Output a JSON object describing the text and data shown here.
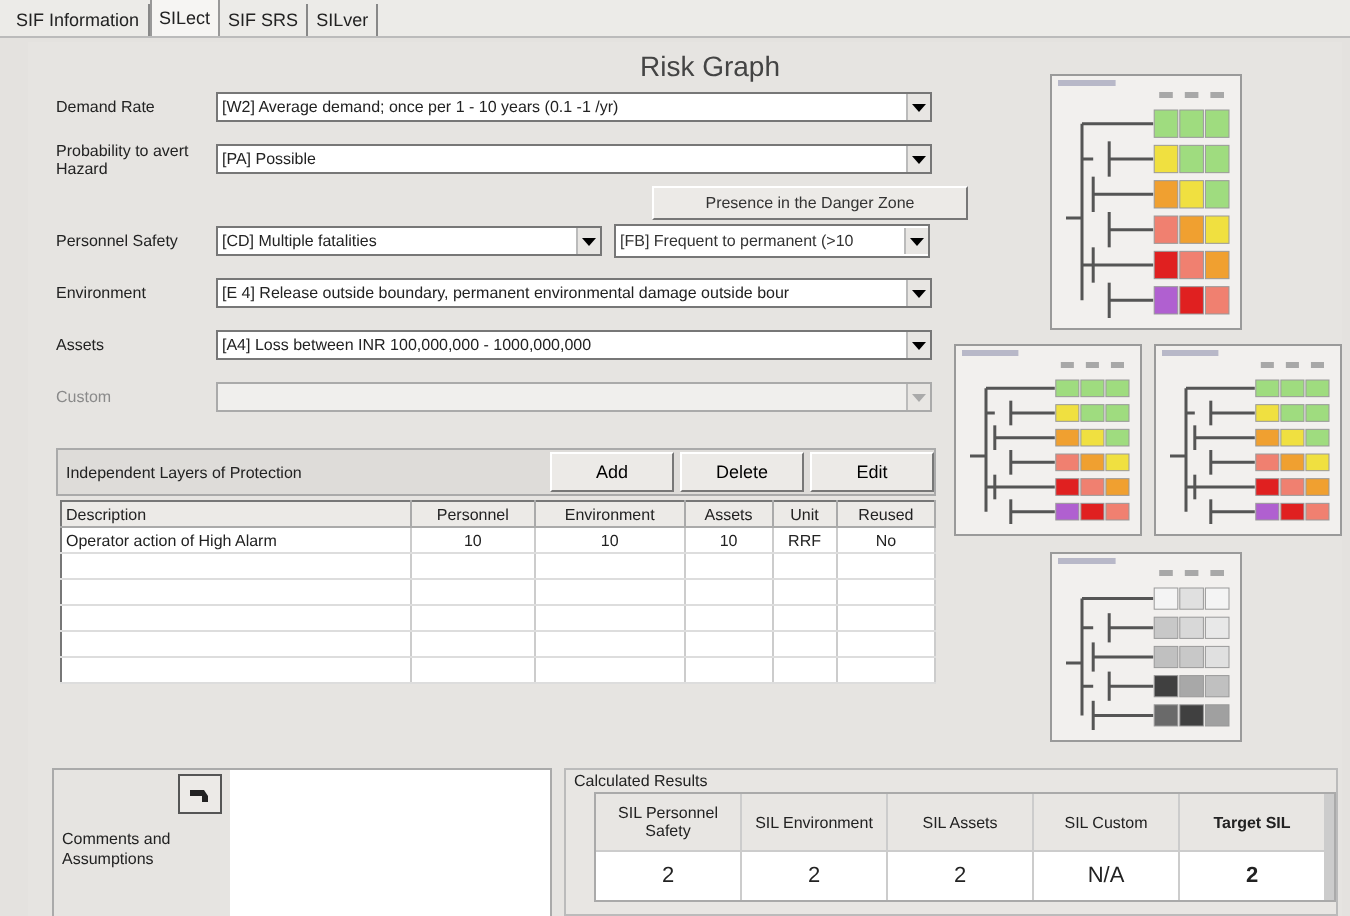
{
  "tabs": [
    {
      "label": "SIF Information",
      "selected": false
    },
    {
      "label": "SILect",
      "selected": true
    },
    {
      "label": "SIF SRS",
      "selected": false
    },
    {
      "label": "SILver",
      "selected": false
    }
  ],
  "title": "Risk Graph",
  "parameters": [
    {
      "kind": "select",
      "label": "Demand Rate",
      "value": "[W2] Average demand; once per 1 - 10 years (0.1 -1 /yr)",
      "disabled": false
    },
    {
      "kind": "select",
      "label": "Probability to avert Hazard",
      "value": "[PA] Possible",
      "disabled": false
    },
    {
      "kind": "split",
      "label": "Personnel Safety",
      "value": "[CD] Multiple fatalities",
      "zone_button": "Presence in the Danger Zone",
      "zone_value": "[FB] Frequent to permanent (>10",
      "disabled": false
    },
    {
      "kind": "select",
      "label": "Environment",
      "value": "[E 4] Release outside boundary, permanent environmental damage outside bour",
      "disabled": false
    },
    {
      "kind": "select",
      "label": "Assets",
      "value": "[A4] Loss between INR 100,000,000 - 1000,000,000",
      "disabled": false
    },
    {
      "kind": "select",
      "label": "Custom",
      "disabled": true
    }
  ],
  "ilp": {
    "title": "Independent Layers of Protection",
    "buttons": [
      "Add",
      "Delete",
      "Edit"
    ],
    "columns": [
      "Description",
      "Personnel",
      "Environment",
      "Assets",
      "Unit",
      "Reused"
    ],
    "rows": [
      [
        "Operator action of High Alarm",
        "10",
        "10",
        "10",
        "RRF",
        "No"
      ]
    ]
  },
  "comments": {
    "label": "Comments and Assumptions"
  },
  "results": {
    "title": "Calculated Results",
    "columns": [
      {
        "label": "SIL Personnel Safety",
        "value": "2",
        "bold": false
      },
      {
        "label": "SIL Environment",
        "value": "2",
        "bold": false
      },
      {
        "label": "SIL Assets",
        "value": "2",
        "bold": false
      },
      {
        "label": "SIL Custom",
        "value": "N/A",
        "bold": false
      },
      {
        "label": "Target SIL",
        "value": "2",
        "bold": true
      }
    ]
  }
}
